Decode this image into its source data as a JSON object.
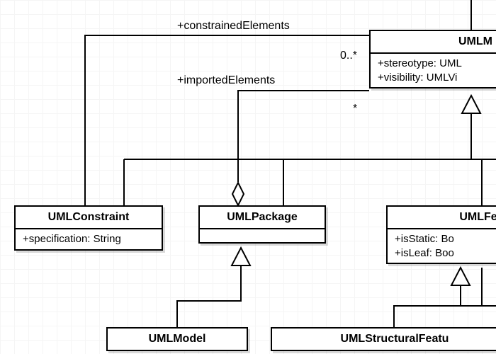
{
  "labels": {
    "constrainedElements": "+constrainedElements",
    "importedElements": "+importedElements",
    "mult_constrained": "0..*",
    "mult_imported": "*"
  },
  "classes": {
    "umlm": {
      "name": "UMLM",
      "attrs": [
        "+stereotype: UML",
        "+visibility: UMLVi"
      ]
    },
    "umlConstraint": {
      "name": "UMLConstraint",
      "attrs": [
        "+specification: String"
      ]
    },
    "umlPackage": {
      "name": "UMLPackage",
      "attrs": []
    },
    "umlFe": {
      "name": "UMLFe",
      "attrs": [
        "+isStatic: Bo",
        "+isLeaf: Boo"
      ]
    },
    "umlModel": {
      "name": "UMLModel",
      "attrs": []
    },
    "umlStructuralFeatu": {
      "name": "UMLStructuralFeatu",
      "attrs": []
    }
  }
}
